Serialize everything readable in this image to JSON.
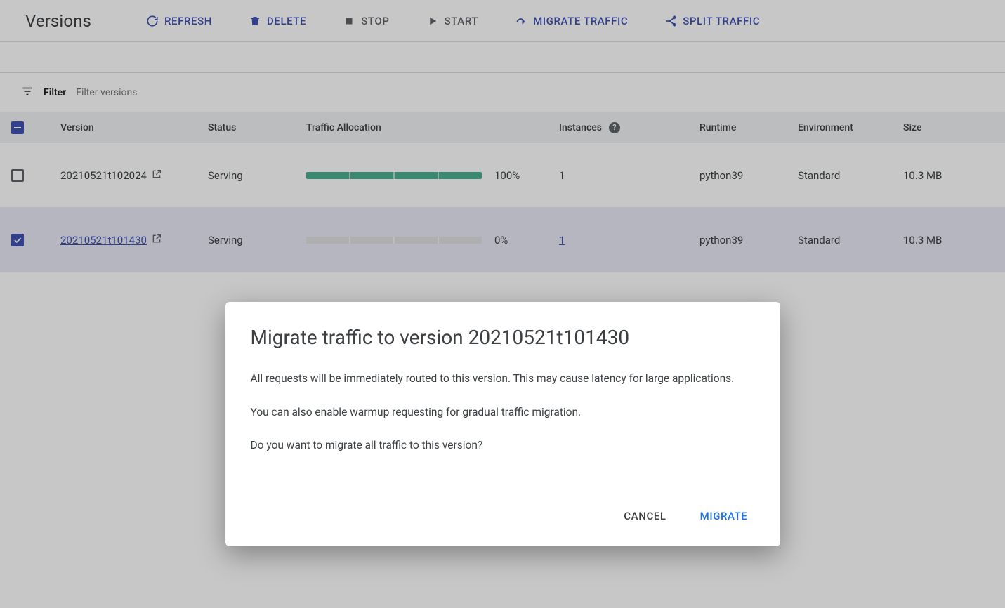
{
  "page": {
    "title": "Versions"
  },
  "toolbar": {
    "refresh": "Refresh",
    "delete": "Delete",
    "stop": "Stop",
    "start": "Start",
    "migrate": "Migrate Traffic",
    "split": "Split Traffic"
  },
  "filter": {
    "label": "Filter",
    "placeholder": "Filter versions"
  },
  "columns": {
    "version": "Version",
    "status": "Status",
    "traffic": "Traffic Allocation",
    "instances": "Instances",
    "runtime": "Runtime",
    "environment": "Environment",
    "size": "Size"
  },
  "rows": [
    {
      "selected": false,
      "version": "20210521t102024",
      "status": "Serving",
      "traffic_pct": 100,
      "traffic_label": "100%",
      "instances": "1",
      "instances_link": false,
      "runtime": "python39",
      "environment": "Standard",
      "size": "10.3 MB"
    },
    {
      "selected": true,
      "version": "20210521t101430",
      "status": "Serving",
      "traffic_pct": 0,
      "traffic_label": "0%",
      "instances": "1",
      "instances_link": true,
      "runtime": "python39",
      "environment": "Standard",
      "size": "10.3 MB"
    }
  ],
  "dialog": {
    "title": "Migrate traffic to version 20210521t101430",
    "p1": "All requests will be immediately routed to this version. This may cause latency for large applications.",
    "p2": "You can also enable warmup requesting for gradual traffic migration.",
    "p3": "Do you want to migrate all traffic to this version?",
    "cancel": "Cancel",
    "confirm": "Migrate"
  }
}
